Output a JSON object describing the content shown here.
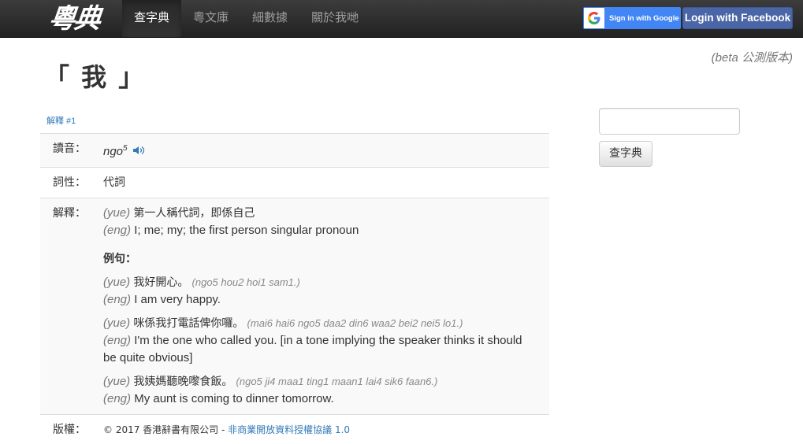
{
  "navbar": {
    "brand": "粵典",
    "items": [
      {
        "label": "查字典",
        "active": true
      },
      {
        "label": "粵文庫",
        "active": false
      },
      {
        "label": "細數據",
        "active": false
      },
      {
        "label": "關於我哋",
        "active": false
      }
    ],
    "google_label": "Sign in with Google",
    "facebook_label": "Login with Facebook"
  },
  "beta_note": "(beta 公測版本)",
  "word": "「 我 」",
  "meaning_link": "解釋 #1",
  "entry": {
    "pronunciation_label": "讀音：",
    "pronunciation_base": "ngo",
    "pronunciation_tone": "5",
    "pos_label": "詞性：",
    "pos_value": "代詞",
    "definition_label": "解釋：",
    "def_yue_tag": "(yue)",
    "def_yue": "第一人稱代詞，即係自己",
    "def_eng_tag": "(eng)",
    "def_eng": "I; me; my; the first person singular pronoun",
    "examples_heading": "例句：",
    "examples": [
      {
        "yue_tag": "(yue)",
        "yue": "我好開心。",
        "jyutping": "(ngo5 hou2 hoi1 sam1.)",
        "eng_tag": "(eng)",
        "eng": "I am very happy."
      },
      {
        "yue_tag": "(yue)",
        "yue": "咪係我打電話俾你囉。",
        "jyutping": "(mai6 hai6 ngo5 daa2 din6 waa2 bei2 nei5 lo1.)",
        "eng_tag": "(eng)",
        "eng": "I'm the one who called you. [in a tone implying the speaker thinks it should be quite obvious]"
      },
      {
        "yue_tag": "(yue)",
        "yue": "我姨媽聽晚嚟食飯。",
        "jyutping": "(ngo5 ji4 maa1 ting1 maan1 lai4 sik6 faan6.)",
        "eng_tag": "(eng)",
        "eng": "My aunt is coming to dinner tomorrow."
      }
    ],
    "copyright_label": "版權：",
    "copyright_text": "© 2017 香港辭書有限公司 - ",
    "license_text": "非商業開放資料授權協議 1.0"
  },
  "search": {
    "placeholder": "",
    "button_label": "查字典"
  },
  "colors": {
    "navbar_bg": "#222222",
    "link": "#337ab7",
    "google": "#4285f4",
    "facebook": "#4b66a6"
  }
}
